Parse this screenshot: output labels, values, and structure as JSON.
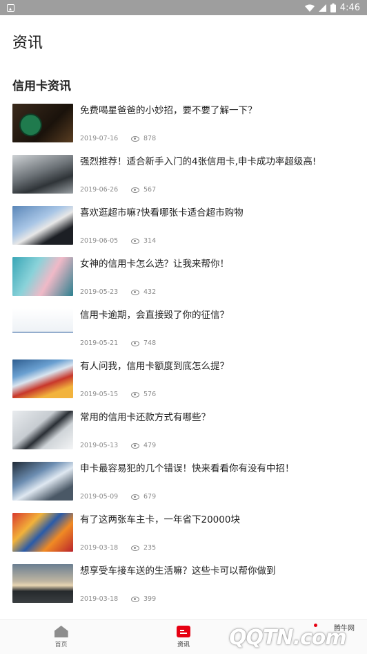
{
  "status_bar": {
    "time": "4:46",
    "icons": [
      "notification-icon",
      "wifi-icon",
      "signal-icon",
      "battery-icon"
    ]
  },
  "header": {
    "title": "资讯"
  },
  "section": {
    "title": "信用卡资讯"
  },
  "news": [
    {
      "title": "免费喝星爸爸的小妙招，要不要了解一下？",
      "date": "2019-07-16",
      "views": "878"
    },
    {
      "title": "强烈推荐！适合新手入门的4张信用卡,申卡成功率超级高!",
      "date": "2019-06-26",
      "views": "567"
    },
    {
      "title": "喜欢逛超市嘛?快看哪张卡适合超市购物",
      "date": "2019-06-05",
      "views": "314"
    },
    {
      "title": "女神的信用卡怎么选？让我来帮你！",
      "date": "2019-05-23",
      "views": "432"
    },
    {
      "title": "信用卡逾期，会直接毁了你的征信？",
      "date": "2019-05-21",
      "views": "748"
    },
    {
      "title": "有人问我，信用卡额度到底怎么提？",
      "date": "2019-05-15",
      "views": "576"
    },
    {
      "title": "常用的信用卡还款方式有哪些？",
      "date": "2019-05-13",
      "views": "479"
    },
    {
      "title": "申卡最容易犯的几个错误！快来看看你有没有中招！",
      "date": "2019-05-09",
      "views": "679"
    },
    {
      "title": "有了这两张车主卡，一年省下20000块",
      "date": "2019-03-18",
      "views": "235"
    },
    {
      "title": "想享受车接车送的生活嘛？这些卡可以帮你做到",
      "date": "2019-03-18",
      "views": "399"
    }
  ],
  "tabs": [
    {
      "label": "首页",
      "icon": "home-icon",
      "active": false
    },
    {
      "label": "资讯",
      "icon": "news-icon",
      "active": true
    }
  ],
  "watermark": {
    "logo": "QQTN.com",
    "cn": "腾牛网"
  },
  "colors": {
    "accent": "#e60012",
    "status_bar": "#9e9e9e",
    "meta_text": "#8a8a8a"
  }
}
